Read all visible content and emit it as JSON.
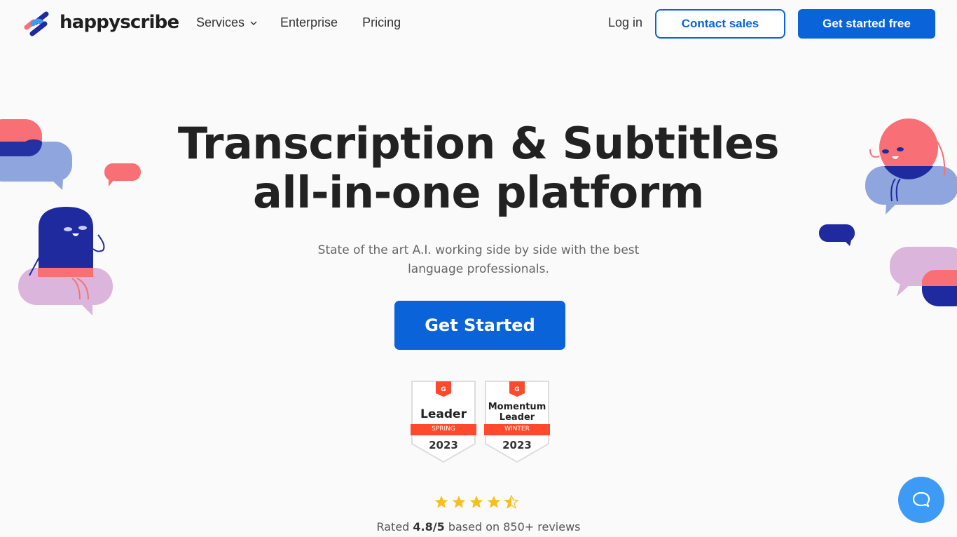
{
  "brand": {
    "name": "happyscribe"
  },
  "nav": {
    "items": [
      {
        "label": "Services",
        "has_dropdown": true
      },
      {
        "label": "Enterprise"
      },
      {
        "label": "Pricing"
      }
    ],
    "login_label": "Log in",
    "contact_sales_label": "Contact sales",
    "get_started_free_label": "Get started free"
  },
  "hero": {
    "title_line1": "Transcription & Subtitles",
    "title_line2": "all-in-one platform",
    "subtitle": "State of the art A.I. working side by side with the best language professionals.",
    "cta_label": "Get Started"
  },
  "badges": [
    {
      "logo": "G2",
      "title": "Leader",
      "season": "SPRING",
      "year": "2023"
    },
    {
      "logo": "G2",
      "title": "Momentum Leader",
      "season": "WINTER",
      "year": "2023"
    }
  ],
  "rating": {
    "stars": 4.5,
    "prefix": "Rated ",
    "score": "4.8/5",
    "suffix": " based on 850+ reviews"
  },
  "chat": {
    "icon": "chat-bubble-icon"
  },
  "colors": {
    "primary": "#0a63d8",
    "coral": "#f87075",
    "navy": "#1e2a9e",
    "periwinkle": "#8ea5dd",
    "lilac": "#dbb5dc",
    "chat": "#3d9bf5",
    "badge_ribbon": "#ff492c"
  }
}
